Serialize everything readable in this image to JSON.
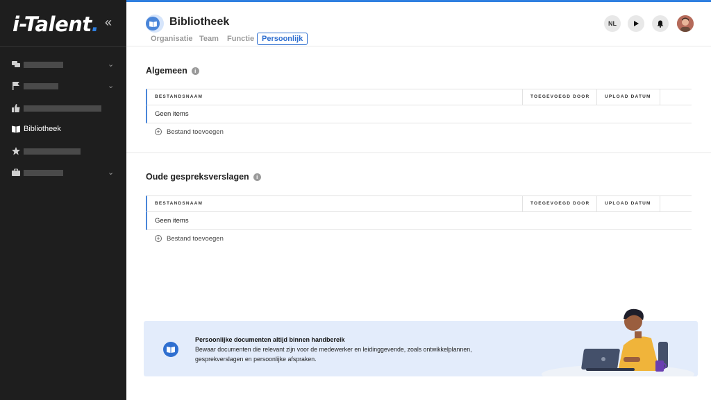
{
  "app": {
    "logo_main": "i-Talent",
    "logo_dot": ".",
    "collapse_glyph": "«"
  },
  "sidebar": {
    "items": [
      {
        "icon": "chat-icon",
        "redacted": true,
        "has_chevron": true
      },
      {
        "icon": "flag-icon",
        "redacted": true,
        "has_chevron": true
      },
      {
        "icon": "thumbs-up-icon",
        "redacted": true,
        "has_chevron": false
      },
      {
        "icon": "book-icon",
        "label": "Bibliotheek",
        "has_chevron": false
      },
      {
        "icon": "star-icon",
        "redacted": true,
        "has_chevron": false
      },
      {
        "icon": "briefcase-icon",
        "redacted": true,
        "has_chevron": true
      }
    ]
  },
  "header": {
    "title": "Bibliotheek",
    "tabs": [
      {
        "label": "Organisatie",
        "active": false
      },
      {
        "label": "Team",
        "active": false
      },
      {
        "label": "Functie",
        "active": false
      },
      {
        "label": "Persoonlijk",
        "active": true
      }
    ],
    "language": "NL",
    "play_icon": "play-icon",
    "bell_icon": "bell-icon"
  },
  "sections": [
    {
      "title": "Algemeen",
      "columns": [
        "BESTANDSNAAM",
        "TOEGEVOEGD DOOR",
        "UPLOAD DATUM"
      ],
      "empty_text": "Geen items",
      "add_label": "Bestand toevoegen"
    },
    {
      "title": "Oude gespreksverslagen",
      "columns": [
        "BESTANDSNAAM",
        "TOEGEVOEGD DOOR",
        "UPLOAD DATUM"
      ],
      "empty_text": "Geen items",
      "add_label": "Bestand toevoegen"
    }
  ],
  "banner": {
    "title": "Persoonlijke documenten altijd binnen handbereik",
    "text": "Bewaar documenten die relevant zijn voor de medewerker en leidinggevende, zoals ontwikkelplannen, gesprekverslagen en persoonlijke afspraken."
  },
  "colors": {
    "accent": "#2f7fe0",
    "sidebar_bg": "#1e1e1e",
    "banner_bg": "#e3ecfb"
  }
}
